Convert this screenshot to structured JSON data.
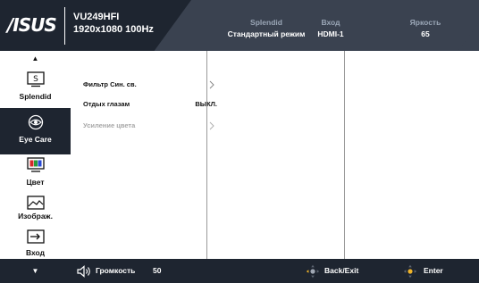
{
  "header": {
    "logo_text": "/ISUS",
    "model": "VU249HFI",
    "resolution": "1920x1080 100Hz",
    "status": [
      {
        "key": "Splendid",
        "value": "Стандартный режим"
      },
      {
        "key": "Вход",
        "value": "HDMI-1"
      },
      {
        "key": "Яркость",
        "value": "65"
      }
    ]
  },
  "sidebar": {
    "up_arrow": "▲",
    "down_arrow": "▼",
    "items": [
      {
        "label": "Splendid",
        "icon": "splendid-icon",
        "active": false
      },
      {
        "label": "Eye Care",
        "icon": "eye-icon",
        "active": true
      },
      {
        "label": "Цвет",
        "icon": "color-icon",
        "active": false
      },
      {
        "label": "Изображ.",
        "icon": "image-icon",
        "active": false
      },
      {
        "label": "Вход",
        "icon": "input-icon",
        "active": false
      }
    ]
  },
  "menu": {
    "items": [
      {
        "label": "Фильтр Син. св.",
        "value": "",
        "submenu": true,
        "enabled": true
      },
      {
        "label": "Отдых глазам",
        "value": "ВЫКЛ.",
        "submenu": false,
        "enabled": true
      },
      {
        "label": "Усиление цвета",
        "value": "",
        "submenu": true,
        "enabled": false
      }
    ]
  },
  "footer": {
    "volume_label": "Громкость",
    "volume_value": "50",
    "back_label": "Back/Exit",
    "enter_label": "Enter"
  },
  "colors": {
    "header_bg": "#1e2530",
    "header_accent": "#3a4250",
    "status_key": "#9aa6b6",
    "disabled_text": "#a8a8a8",
    "text": "#111111"
  }
}
